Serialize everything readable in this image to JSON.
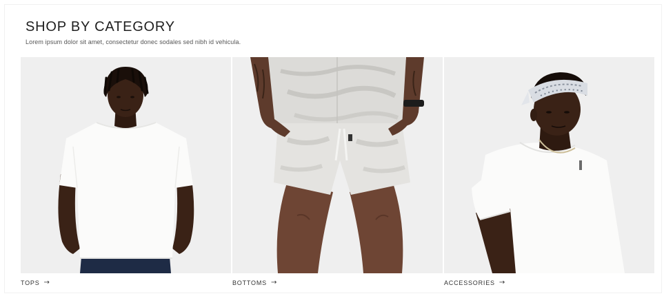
{
  "section": {
    "title": "SHOP BY CATEGORY",
    "subtitle": "Lorem ipsum dolor sit amet, consectetur donec sodales sed nibh id vehicula."
  },
  "categories": [
    {
      "label": "TOPS",
      "icon": "arrow-right-icon"
    },
    {
      "label": "BOTTOMS",
      "icon": "arrow-right-icon"
    },
    {
      "label": "ACCESSORIES",
      "icon": "arrow-right-icon"
    }
  ],
  "colors": {
    "card_background": "#efefef",
    "text": "#222222"
  }
}
